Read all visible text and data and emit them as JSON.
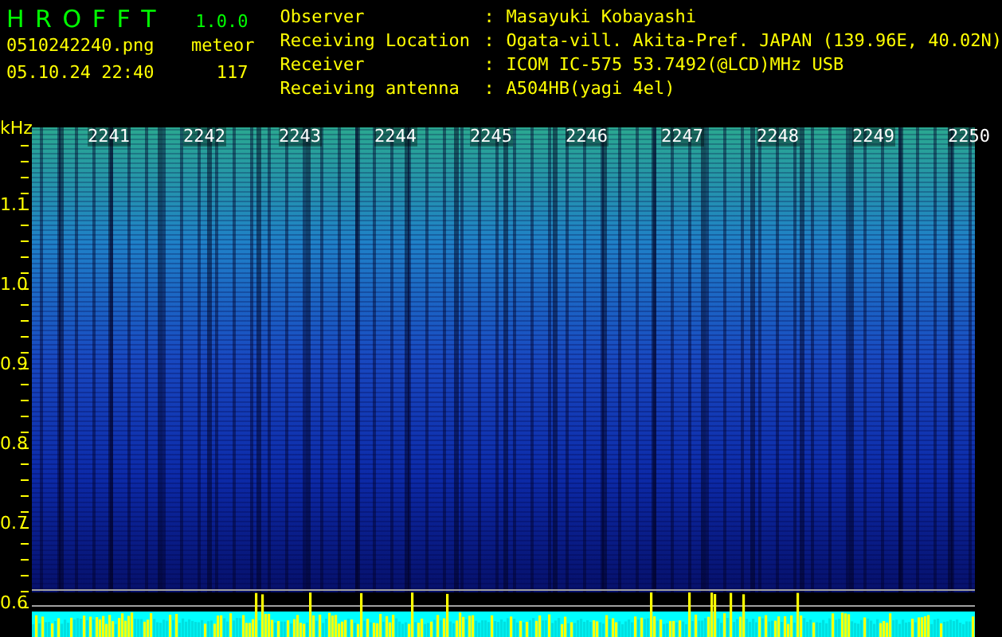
{
  "app": {
    "title": "H R O F F T",
    "version": "1.0.0"
  },
  "file": {
    "name": "0510242240.png",
    "timestamp": "05.10.24 22:40"
  },
  "counter": {
    "label": "meteor",
    "value": "117"
  },
  "station_info": [
    {
      "label": "Observer",
      "separator": ":",
      "value": "Masayuki Kobayashi"
    },
    {
      "label": "Receiving Location",
      "separator": ":",
      "value": "Ogata-vill. Akita-Pref. JAPAN (139.96E, 40.02N)"
    },
    {
      "label": "Receiver",
      "separator": ":",
      "value": "ICOM IC-575 53.7492(@LCD)MHz USB"
    },
    {
      "label": "Receiving antenna",
      "separator": ":",
      "value": "A504HB(yagi 4el)"
    }
  ],
  "spectrogram": {
    "y_unit": "kHz",
    "y_labels": [
      "1.1",
      "1.0",
      "0.9",
      "0.8",
      "0.7",
      "0.6"
    ],
    "time_labels": [
      "2241",
      "2242",
      "2243",
      "2244",
      "2245",
      "2246",
      "2247",
      "2248",
      "2249",
      "2250"
    ]
  }
}
